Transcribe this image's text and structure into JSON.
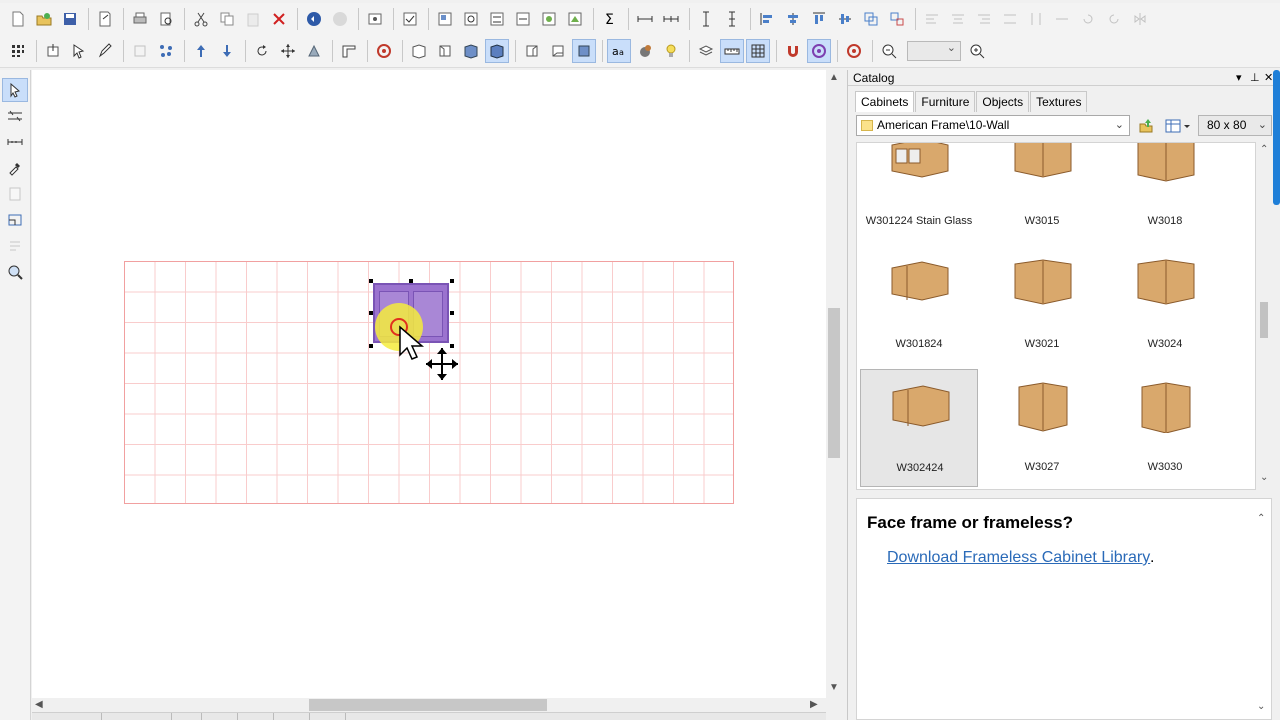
{
  "catalog": {
    "title": "Catalog",
    "tabs": [
      {
        "label": "Cabinets",
        "active": true
      },
      {
        "label": "Furniture",
        "active": false
      },
      {
        "label": "Objects",
        "active": false
      },
      {
        "label": "Textures",
        "active": false
      }
    ],
    "library_path": "American Frame\\10-Wall",
    "thumb_size": "80 x  80",
    "items": [
      {
        "label": "W301224 Stain Glass",
        "selected": false
      },
      {
        "label": "W3015",
        "selected": false
      },
      {
        "label": "W3018",
        "selected": false
      },
      {
        "label": "W301824",
        "selected": false
      },
      {
        "label": "W3021",
        "selected": false
      },
      {
        "label": "W3024",
        "selected": false
      },
      {
        "label": "W302424",
        "selected": true
      },
      {
        "label": "W3027",
        "selected": false
      },
      {
        "label": "W3030",
        "selected": false
      }
    ],
    "info": {
      "heading": "Face frame or frameless?",
      "link_text": "Download Frameless Cabinet Library",
      "trailing": "."
    }
  },
  "colors": {
    "cabinet_fill": "#9b73cf",
    "wood": "#d9a86c",
    "grid_line": "#f9cccc",
    "link": "#2a6ab8"
  }
}
